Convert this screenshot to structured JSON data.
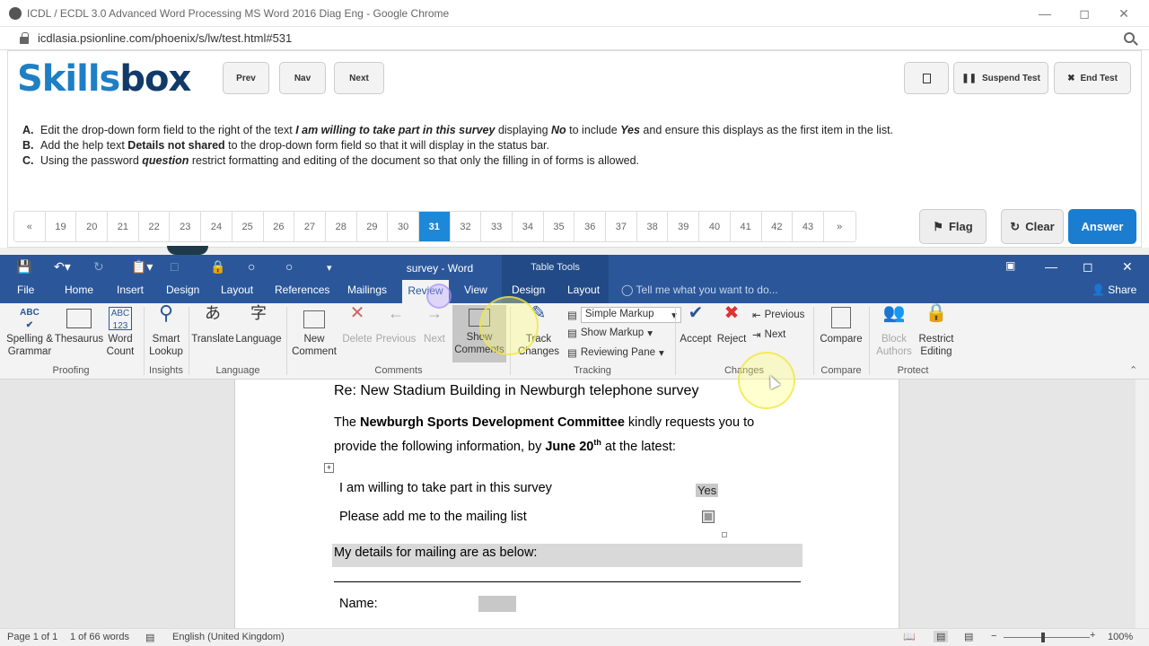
{
  "chrome": {
    "title": "ICDL / ECDL 3.0 Advanced Word Processing MS Word 2016 Diag Eng - Google Chrome",
    "url": "icdlasia.psionline.com/phoenix/s/lw/test.html#531"
  },
  "test": {
    "logo_part1": "Skills",
    "logo_part2": "box",
    "prev": "Prev",
    "nav": "Nav",
    "next": "Next",
    "suspend": "Suspend Test",
    "end": "End Test",
    "instructions": [
      {
        "label": "A.",
        "pre": "Edit the drop-down form field to the right of the text ",
        "em1": "I am willing to take part in this survey",
        "mid1": " displaying ",
        "em2": "No",
        "mid2": " to include ",
        "em3": "Yes",
        "post": " and ensure this displays as the first item in the list."
      },
      {
        "label": "B.",
        "pre": "Add the help text ",
        "em1": "Details not shared",
        "post": " to the drop-down form field so that it will display in the status bar."
      },
      {
        "label": "C.",
        "pre": "Using the password ",
        "em1": "question",
        "post": " restrict formatting and editing of the document so that only the filling in of forms is allowed."
      }
    ],
    "pages": [
      "«",
      "19",
      "20",
      "21",
      "22",
      "23",
      "24",
      "25",
      "26",
      "27",
      "28",
      "29",
      "30",
      "31",
      "32",
      "33",
      "34",
      "35",
      "36",
      "37",
      "38",
      "39",
      "40",
      "41",
      "42",
      "43",
      "»"
    ],
    "current_page": "31",
    "flag": "Flag",
    "clear": "Clear",
    "answer": "Answer"
  },
  "word": {
    "title": "survey - Word",
    "table_tools": "Table Tools",
    "menu": [
      "File",
      "Home",
      "Insert",
      "Design",
      "Layout",
      "References",
      "Mailings",
      "Review",
      "View",
      "Design",
      "Layout"
    ],
    "tell_me": "Tell me what you want to do...",
    "share": "Share",
    "ribbon": {
      "spelling": "Spelling &\nGrammar",
      "thesaurus": "Thesaurus",
      "word_count": "Word\nCount",
      "smart_lookup": "Smart\nLookup",
      "translate": "Translate",
      "language": "Language",
      "new_comment": "New\nComment",
      "delete": "Delete",
      "previous": "Previous",
      "next": "Next",
      "show_comments": "Show\nComments",
      "track_changes": "Track\nChanges",
      "simple_markup": "Simple Markup",
      "show_markup": "Show Markup",
      "reviewing_pane": "Reviewing Pane",
      "accept": "Accept",
      "reject": "Reject",
      "changes_previous": "Previous",
      "changes_next": "Next",
      "compare": "Compare",
      "block_authors": "Block\nAuthors",
      "restrict_editing": "Restrict\nEditing",
      "groups": {
        "proofing": "Proofing",
        "insights": "Insights",
        "language": "Language",
        "comments": "Comments",
        "tracking": "Tracking",
        "changes": "Changes",
        "compare": "Compare",
        "protect": "Protect"
      }
    },
    "doc": {
      "heading": "Re: New Stadium Building in Newburgh telephone survey",
      "para_pre": "The ",
      "para_bold": "Newburgh Sports Development Committee",
      "para_post": " kindly requests you to",
      "para2_pre": "provide the following information, by ",
      "para2_bold": "June 20",
      "para2_sup": "th",
      "para2_post": " at the latest:",
      "q1": "I am willing to take part in this survey",
      "q1_value": "Yes",
      "q2": "Please add me to the mailing list",
      "mailing": "My details for mailing are as below:",
      "name_label": "Name:"
    },
    "status": {
      "page": "Page 1 of 1",
      "words": "1 of 66 words",
      "language": "English (United Kingdom)",
      "zoom": "100%"
    }
  }
}
